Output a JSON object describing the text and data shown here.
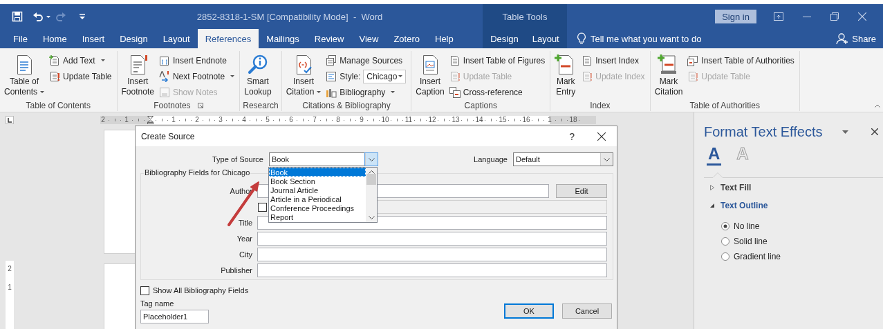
{
  "title_bar": {
    "title": "2852-8318-1-SM [Compatibility Mode]  -  Word",
    "context_label": "Table Tools",
    "sign_in": "Sign in"
  },
  "tabs": [
    {
      "label": "File",
      "selected": false,
      "contextual": false
    },
    {
      "label": "Home",
      "selected": false,
      "contextual": false
    },
    {
      "label": "Insert",
      "selected": false,
      "contextual": false
    },
    {
      "label": "Design",
      "selected": false,
      "contextual": false
    },
    {
      "label": "Layout",
      "selected": false,
      "contextual": false
    },
    {
      "label": "References",
      "selected": true,
      "contextual": false
    },
    {
      "label": "Mailings",
      "selected": false,
      "contextual": false
    },
    {
      "label": "Review",
      "selected": false,
      "contextual": false
    },
    {
      "label": "View",
      "selected": false,
      "contextual": false
    },
    {
      "label": "Zotero",
      "selected": false,
      "contextual": false
    },
    {
      "label": "Help",
      "selected": false,
      "contextual": false
    },
    {
      "label": "Design",
      "selected": false,
      "contextual": true
    },
    {
      "label": "Layout",
      "selected": false,
      "contextual": true
    }
  ],
  "tell_me": "Tell me what you want to do",
  "share": "Share",
  "ribbon": {
    "groups": [
      {
        "label": "Table of Contents",
        "launcher": false,
        "items": [
          {
            "kind": "large",
            "lines": [
              "Table of",
              "Contents"
            ],
            "menu": true,
            "disabled": false
          },
          {
            "kind": "small",
            "label": "Add Text",
            "menu": true,
            "disabled": false
          },
          {
            "kind": "small",
            "label": "Update Table",
            "menu": false,
            "disabled": false
          }
        ]
      },
      {
        "label": "Footnotes",
        "launcher": true,
        "items": [
          {
            "kind": "large",
            "lines": [
              "Insert",
              "Footnote"
            ],
            "menu": false,
            "disabled": false
          },
          {
            "kind": "small",
            "label": "Insert Endnote",
            "menu": false,
            "disabled": false
          },
          {
            "kind": "small",
            "label": "Next Footnote",
            "menu": true,
            "disabled": false
          },
          {
            "kind": "small",
            "label": "Show Notes",
            "menu": false,
            "disabled": true
          }
        ]
      },
      {
        "label": "Research",
        "launcher": false,
        "items": [
          {
            "kind": "large",
            "lines": [
              "Smart",
              "Lookup"
            ],
            "menu": false,
            "disabled": false
          }
        ]
      },
      {
        "label": "Citations & Bibliography",
        "launcher": false,
        "items": [
          {
            "kind": "large",
            "lines": [
              "Insert",
              "Citation"
            ],
            "menu": true,
            "disabled": false
          },
          {
            "kind": "small",
            "label": "Manage Sources",
            "menu": false,
            "disabled": false
          },
          {
            "kind": "combo",
            "label": "Style:",
            "value": "Chicago",
            "menu": true,
            "disabled": false
          },
          {
            "kind": "small",
            "label": "Bibliography",
            "menu": true,
            "disabled": false
          }
        ]
      },
      {
        "label": "Captions",
        "launcher": false,
        "items": [
          {
            "kind": "large",
            "lines": [
              "Insert",
              "Caption"
            ],
            "menu": false,
            "disabled": false
          },
          {
            "kind": "small",
            "label": "Insert Table of Figures",
            "menu": false,
            "disabled": false
          },
          {
            "kind": "small",
            "label": "Update Table",
            "menu": false,
            "disabled": true
          },
          {
            "kind": "small",
            "label": "Cross-reference",
            "menu": false,
            "disabled": false
          }
        ]
      },
      {
        "label": "Index",
        "launcher": false,
        "items": [
          {
            "kind": "large",
            "lines": [
              "Mark",
              "Entry"
            ],
            "menu": false,
            "disabled": false
          },
          {
            "kind": "small",
            "label": "Insert Index",
            "menu": false,
            "disabled": false
          },
          {
            "kind": "small",
            "label": "Update Index",
            "menu": false,
            "disabled": true
          }
        ]
      },
      {
        "label": "Table of Authorities",
        "launcher": false,
        "items": [
          {
            "kind": "large",
            "lines": [
              "Mark",
              "Citation"
            ],
            "menu": false,
            "disabled": false
          },
          {
            "kind": "small",
            "label": "Insert Table of Authorities",
            "menu": false,
            "disabled": false
          },
          {
            "kind": "small",
            "label": "Update Table",
            "menu": false,
            "disabled": true
          }
        ]
      }
    ]
  },
  "ruler": [
    {
      "kind": "number",
      "label": "2"
    },
    {
      "kind": "number",
      "label": "1"
    },
    {
      "kind": "marker"
    },
    {
      "kind": "number",
      "label": "1"
    },
    {
      "kind": "number",
      "label": "2"
    },
    {
      "kind": "number",
      "label": "3"
    },
    {
      "kind": "number",
      "label": "4"
    },
    {
      "kind": "number",
      "label": "5"
    },
    {
      "kind": "number",
      "label": "6"
    },
    {
      "kind": "number",
      "label": "7"
    },
    {
      "kind": "number",
      "label": "8"
    },
    {
      "kind": "number",
      "label": "9"
    },
    {
      "kind": "number",
      "label": "10"
    },
    {
      "kind": "number",
      "label": "11"
    },
    {
      "kind": "number",
      "label": "12"
    },
    {
      "kind": "number",
      "label": "13"
    },
    {
      "kind": "number",
      "label": "14"
    },
    {
      "kind": "number",
      "label": "15"
    },
    {
      "kind": "number",
      "label": "16"
    },
    {
      "kind": "number",
      "label": "1"
    },
    {
      "kind": "number",
      "label": "18"
    }
  ],
  "vertical_ruler": [
    "2",
    "1"
  ],
  "dialog": {
    "title": "Create Source",
    "help": "?",
    "source_type": {
      "label": "Type of Source",
      "value": "Book",
      "expanded": true,
      "options": [
        {
          "label": "Book",
          "selected": true
        },
        {
          "label": "Book Section",
          "selected": false
        },
        {
          "label": "Journal Article",
          "selected": false
        },
        {
          "label": "Article in a Periodical",
          "selected": false
        },
        {
          "label": "Conference Proceedings",
          "selected": false
        },
        {
          "label": "Report",
          "selected": false
        }
      ]
    },
    "language": {
      "label": "Language",
      "value": "Default"
    },
    "fields_title": "Bibliography Fields for Chicago",
    "fields": [
      {
        "kind": "author",
        "label": "Author",
        "button": "Edit"
      },
      {
        "kind": "check",
        "checked": false,
        "disabled": true
      },
      {
        "kind": "text",
        "label": "Title"
      },
      {
        "kind": "text",
        "label": "Year"
      },
      {
        "kind": "text",
        "label": "City"
      },
      {
        "kind": "text",
        "label": "Publisher"
      }
    ],
    "show_all": {
      "label": "Show All Bibliography Fields",
      "checked": false
    },
    "tag": {
      "label": "Tag name",
      "value": "Placeholder1"
    },
    "buttons": [
      {
        "label": "OK",
        "default": true
      },
      {
        "label": "Cancel",
        "default": false
      }
    ]
  },
  "pane": {
    "title": "Format Text Effects",
    "tabs": [
      {
        "glyph": "A",
        "selected": true
      },
      {
        "glyph": "A",
        "selected": false
      }
    ],
    "sections": [
      {
        "label": "Text Fill",
        "expanded": false
      },
      {
        "label": "Text Outline",
        "expanded": true,
        "options": [
          {
            "label": "No line",
            "selected": true
          },
          {
            "label": "Solid line",
            "selected": false
          },
          {
            "label": "Gradient line",
            "selected": false
          }
        ]
      }
    ]
  }
}
